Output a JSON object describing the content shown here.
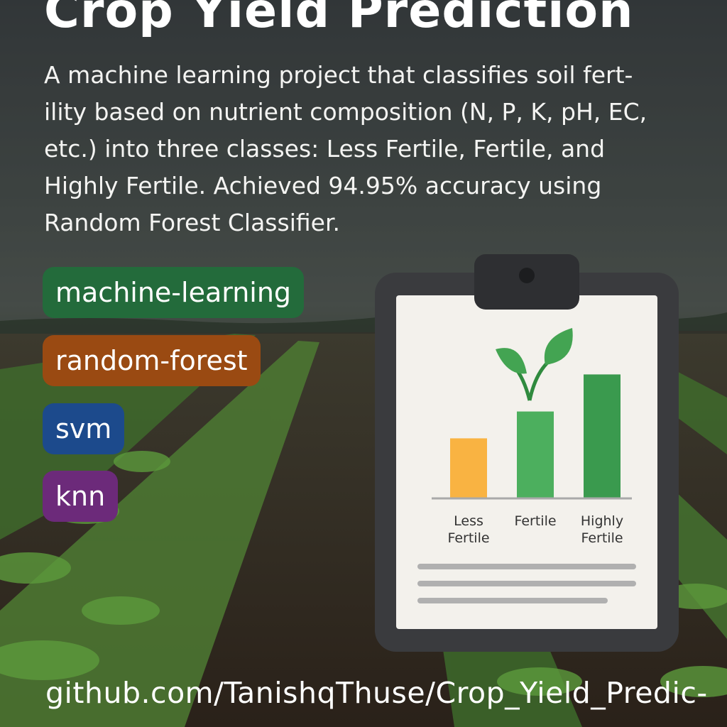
{
  "title": "Crop Yield Prediction",
  "description_lines": [
    "A machine learning project that classifies soil fert-",
    "ility based on nutrient composition (N, P, K, pH, EC,",
    "etc.) into three classes: Less Fertile, Fertile, and",
    "Highly Fertile. Achieved 94.95% accuracy using",
    "Random Forest Classifier."
  ],
  "tags": [
    {
      "label": "machine-learning",
      "color": "#236b3b"
    },
    {
      "label": "random-forest",
      "color": "#9a4a12"
    },
    {
      "label": "svm",
      "color": "#1c4a8c"
    },
    {
      "label": "knn",
      "color": "#6c2a7a"
    }
  ],
  "clipboard": {
    "icon": "clipboard-icon",
    "plant_icon": "sprout-icon",
    "chart_data": {
      "type": "bar",
      "categories": [
        [
          "Less",
          "Fertile"
        ],
        [
          "Fertile"
        ],
        [
          "Highly",
          "Fertile"
        ]
      ],
      "values": [
        0.47,
        0.68,
        0.97
      ],
      "colors": [
        "#f9b342",
        "#4caf5e",
        "#3a9a4e"
      ]
    }
  },
  "repo_link": "github.com/TanishqThuse/Crop_Yield_Predic-"
}
